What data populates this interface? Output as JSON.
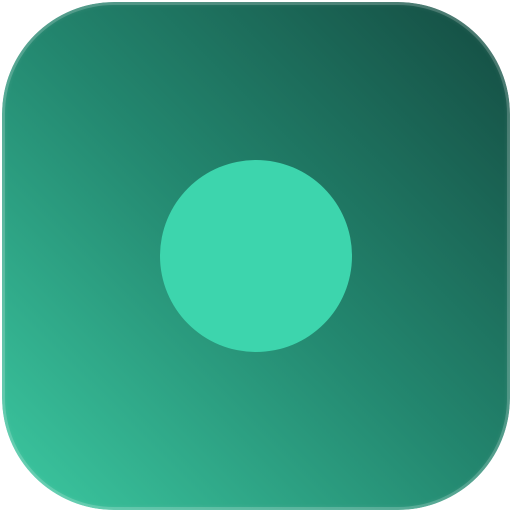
{
  "icon": {
    "name": "green-dot-app-icon",
    "colors": {
      "gradient_start": "#3cc9a1",
      "gradient_mid": "#23876f",
      "gradient_end": "#144b41",
      "dot": "#3dd5ad"
    }
  }
}
